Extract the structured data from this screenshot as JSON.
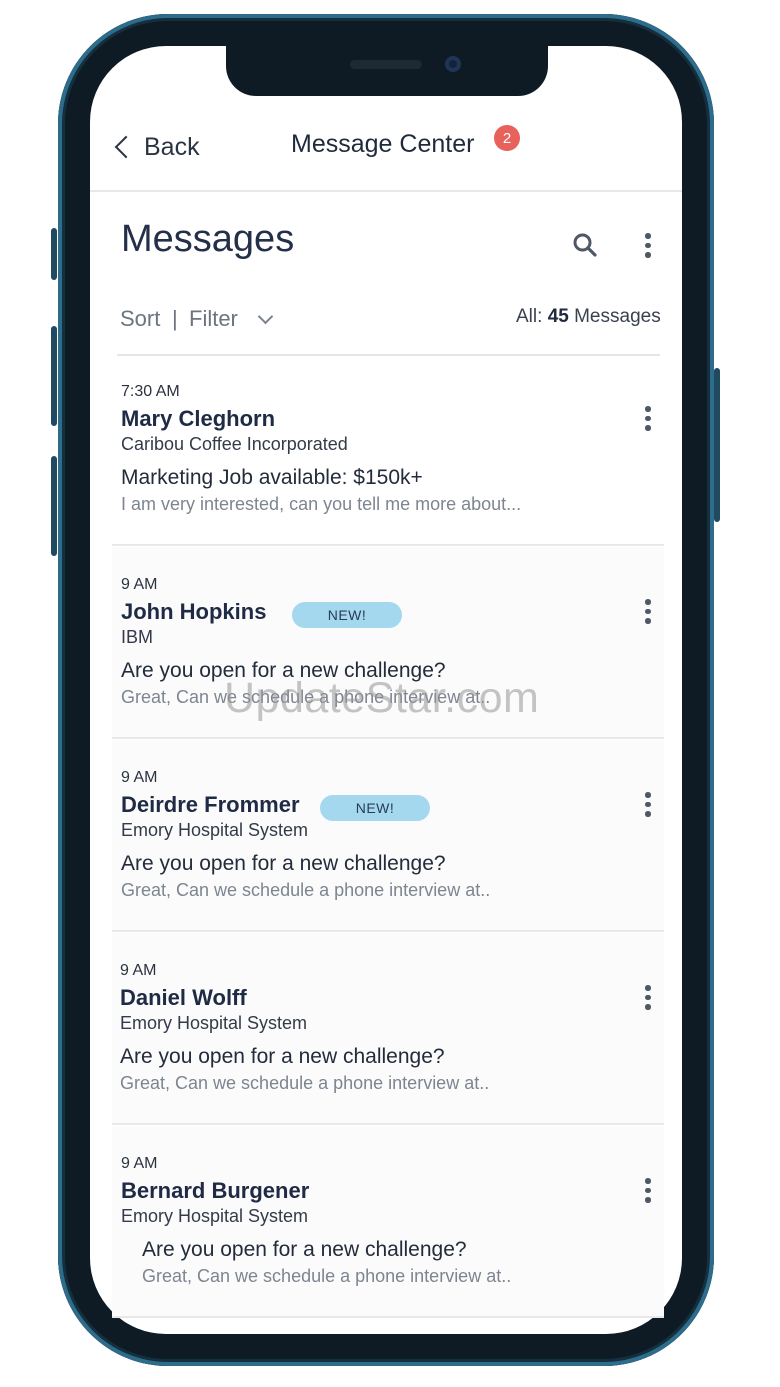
{
  "nav": {
    "back_label": "Back",
    "title": "Message Center",
    "badge_count": "2"
  },
  "header": {
    "title": "Messages",
    "sort_label": "Sort",
    "separator": "|",
    "filter_label": "Filter",
    "count_prefix": "All:",
    "count_value": "45",
    "count_suffix": "Messages"
  },
  "messages": [
    {
      "time": "7:30 AM",
      "name": "Mary Cleghorn",
      "company": "Caribou Coffee Incorporated",
      "subject": "Marketing Job available: $150k+",
      "preview": "I am very interested, can you tell me more about...",
      "badge": ""
    },
    {
      "time": "9 AM",
      "name": "John Hopkins",
      "company": "IBM",
      "subject": "Are you open for a new challenge?",
      "preview": "Great, Can we schedule a phone interview at..",
      "badge": "NEW!"
    },
    {
      "time": "9 AM",
      "name": "Deirdre Frommer",
      "company": "Emory Hospital System",
      "subject": "Are you open for a new challenge?",
      "preview": "Great, Can we schedule a phone interview at..",
      "badge": "NEW!"
    },
    {
      "time": "9 AM",
      "name": "Daniel Wolff",
      "company": "Emory Hospital System",
      "subject": "Are you open for a new challenge?",
      "preview": "Great, Can we schedule a phone interview at..",
      "badge": ""
    },
    {
      "time": "9 AM",
      "name": "Bernard Burgener",
      "company": "Emory Hospital System",
      "subject": "Are you open for a new challenge?",
      "preview": "Great, Can we schedule a phone interview at..",
      "badge": ""
    }
  ],
  "watermark": "UpdateStar.com",
  "colors": {
    "badge_red": "#e8615b",
    "new_badge": "#a3d8ef",
    "frame": "#0f1b24",
    "frame_accent": "#2e6c8c"
  },
  "icons": [
    "chevron-left-icon",
    "search-icon",
    "more-vertical-icon",
    "chevron-down-icon"
  ]
}
